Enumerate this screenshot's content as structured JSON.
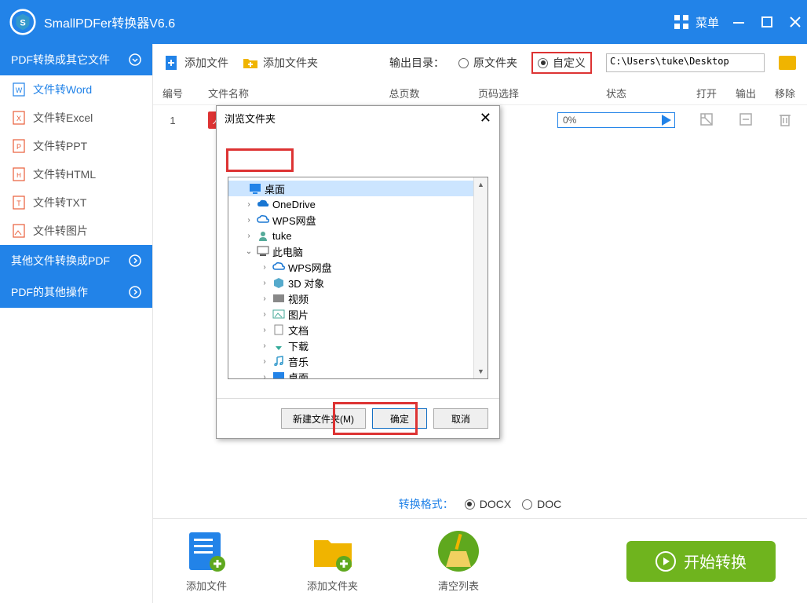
{
  "titlebar": {
    "app_title": "SmallPDFer转换器V6.6",
    "menu": "菜单"
  },
  "sidebar": {
    "group1": "PDF转换成其它文件",
    "items": [
      {
        "label": "文件转Word"
      },
      {
        "label": "文件转Excel"
      },
      {
        "label": "文件转PPT"
      },
      {
        "label": "文件转HTML"
      },
      {
        "label": "文件转TXT"
      },
      {
        "label": "文件转图片"
      }
    ],
    "group2": "其他文件转换成PDF",
    "group3": "PDF的其他操作"
  },
  "toolbar": {
    "add_file": "添加文件",
    "add_folder": "添加文件夹",
    "output_dir": "输出目录：",
    "radio_original": "原文件夹",
    "radio_custom": "自定义",
    "path": "C:\\Users\\tuke\\Desktop"
  },
  "table": {
    "headers": {
      "num": "编号",
      "name": "文件名称",
      "pages": "总页数",
      "sel": "页码选择",
      "state": "状态",
      "open": "打开",
      "out": "输出",
      "rm": "移除"
    },
    "row": {
      "num": "1",
      "progress": "0%"
    }
  },
  "format": {
    "label": "转换格式：",
    "opt1": "DOCX",
    "opt2": "DOC"
  },
  "bottom": {
    "add_file": "添加文件",
    "add_folder": "添加文件夹",
    "clear": "清空列表",
    "start": "开始转换"
  },
  "dialog": {
    "title": "浏览文件夹",
    "tree": {
      "desktop": "桌面",
      "onedrive": "OneDrive",
      "wps": "WPS网盘",
      "tuke": "tuke",
      "thispc": "此电脑",
      "wps2": "WPS网盘",
      "objects3d": "3D 对象",
      "videos": "视频",
      "pictures": "图片",
      "docs": "文档",
      "downloads": "下载",
      "music": "音乐",
      "desktop2": "桌面"
    },
    "new_folder": "新建文件夹(M)",
    "ok": "确定",
    "cancel": "取消"
  }
}
